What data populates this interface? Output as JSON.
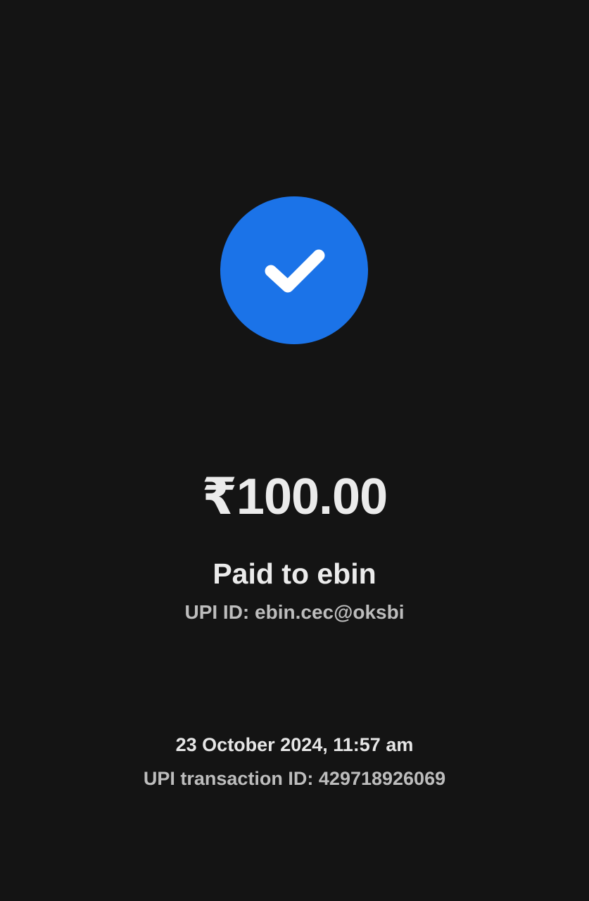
{
  "colors": {
    "background": "#141414",
    "success_badge": "#1b73e8",
    "check_mark": "#ffffff",
    "primary_text": "#ebebeb",
    "secondary_text": "#bdbdbd"
  },
  "status": {
    "icon": "check-icon"
  },
  "payment": {
    "amount": "₹100.00",
    "paid_to": "Paid to ebin",
    "upi_id": "UPI ID: ebin.cec@oksbi"
  },
  "transaction": {
    "datetime": "23 October 2024, 11:57 am",
    "upi_transaction_id": "UPI transaction ID: 429718926069"
  }
}
